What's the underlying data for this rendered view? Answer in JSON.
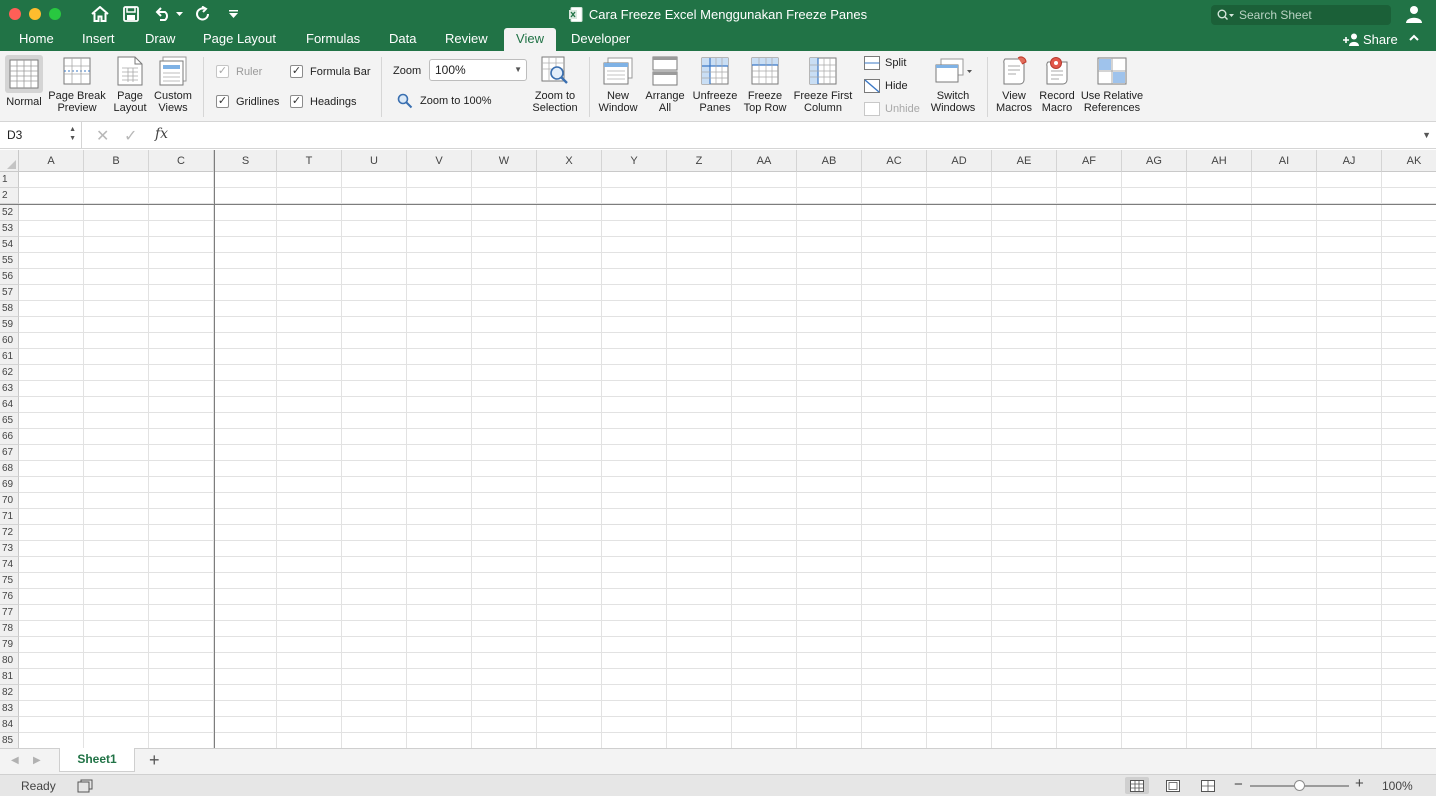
{
  "window": {
    "title": "Cara Freeze Excel Menggunakan Freeze Panes",
    "search_placeholder": "Search Sheet"
  },
  "tabs": [
    "Home",
    "Insert",
    "Draw",
    "Page Layout",
    "Formulas",
    "Data",
    "Review",
    "View",
    "Developer"
  ],
  "active_tab": "View",
  "share_label": "Share",
  "ribbon": {
    "workbook_views": {
      "normal": "Normal",
      "page_break_1": "Page Break",
      "page_break_2": "Preview",
      "page_layout_1": "Page",
      "page_layout_2": "Layout",
      "custom_views_1": "Custom",
      "custom_views_2": "Views"
    },
    "show": {
      "ruler": "Ruler",
      "formula_bar": "Formula Bar",
      "gridlines": "Gridlines",
      "headings": "Headings"
    },
    "zoom": {
      "label": "Zoom",
      "value": "100%",
      "zoom_to_100": "Zoom to 100%",
      "zoom_selection_1": "Zoom to",
      "zoom_selection_2": "Selection"
    },
    "window": {
      "new_window_1": "New",
      "new_window_2": "Window",
      "arrange_1": "Arrange",
      "arrange_2": "All",
      "unfreeze_1": "Unfreeze",
      "unfreeze_2": "Panes",
      "freeze_top_1": "Freeze",
      "freeze_top_2": "Top Row",
      "freeze_first_1": "Freeze First",
      "freeze_first_2": "Column",
      "split": "Split",
      "hide": "Hide",
      "unhide": "Unhide",
      "switch_1": "Switch",
      "switch_2": "Windows"
    },
    "macros": {
      "view_1": "View",
      "view_2": "Macros",
      "record_1": "Record",
      "record_2": "Macro",
      "relative_1": "Use Relative",
      "relative_2": "References"
    }
  },
  "formula_bar": {
    "name_box": "D3",
    "fx": "fx",
    "value": ""
  },
  "grid": {
    "frozen_columns": [
      "A",
      "B",
      "C"
    ],
    "scroll_columns": [
      "S",
      "T",
      "U",
      "V",
      "W",
      "X",
      "Y",
      "Z",
      "AA",
      "AB",
      "AC",
      "AD",
      "AE",
      "AF",
      "AG",
      "AH",
      "AI",
      "AJ",
      "AK"
    ],
    "frozen_rows": [
      "1",
      "2"
    ],
    "scroll_rows": [
      "52",
      "53",
      "54",
      "55",
      "56",
      "57",
      "58",
      "59",
      "60",
      "61",
      "62",
      "63",
      "64",
      "65",
      "66",
      "67",
      "68",
      "69",
      "70",
      "71",
      "72",
      "73",
      "74",
      "75",
      "76",
      "77",
      "78",
      "79",
      "80",
      "81",
      "82",
      "83",
      "84",
      "85"
    ]
  },
  "sheets": [
    "Sheet1"
  ],
  "status": {
    "ready": "Ready",
    "zoom": "100%"
  },
  "colors": {
    "brand": "#217346",
    "grid_line": "#e2e2e2",
    "freeze_line": "#7d7d7d"
  }
}
